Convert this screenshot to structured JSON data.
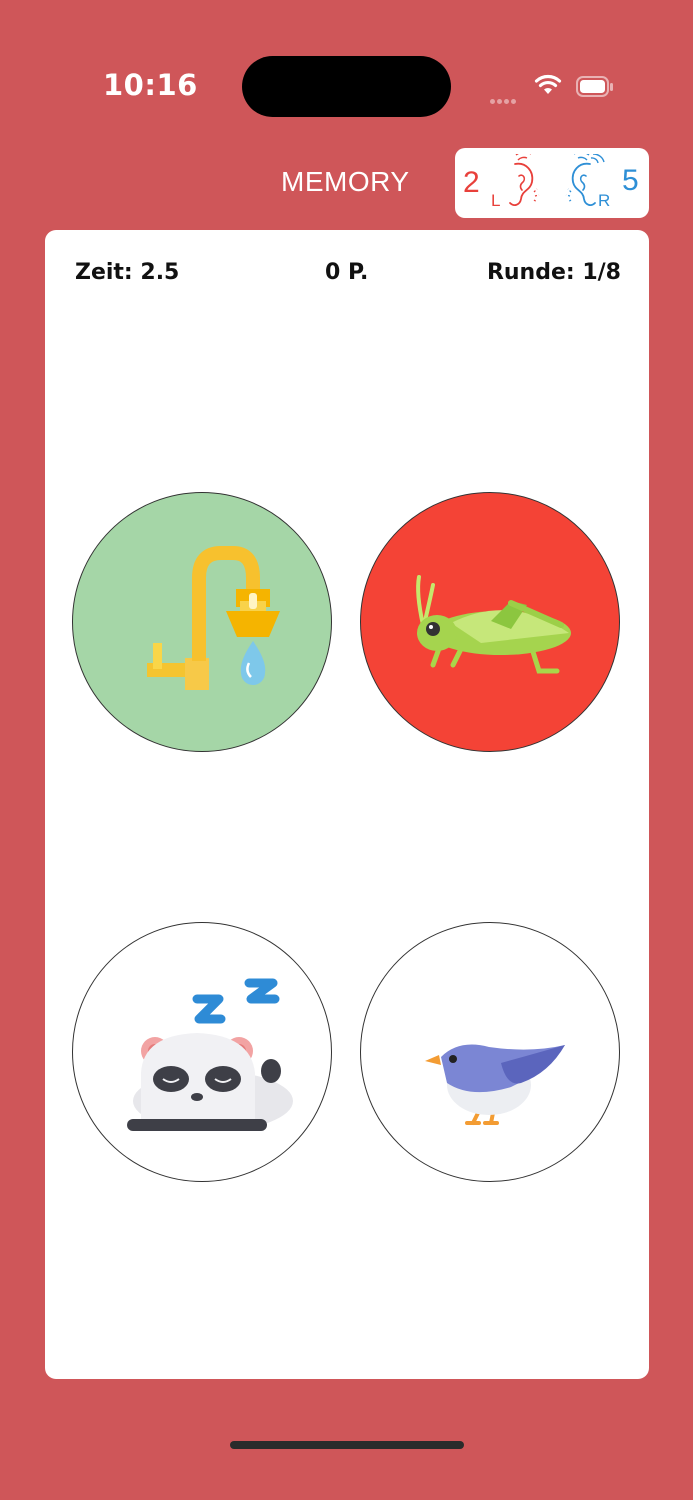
{
  "status_bar": {
    "time": "10:16",
    "icons": [
      "signal-dots-icon",
      "wifi-icon",
      "battery-icon"
    ]
  },
  "header": {
    "title": "MEMORY",
    "hearing": {
      "left_value": "2",
      "left_side": "L",
      "right_value": "5",
      "right_side": "R",
      "left_color": "#e8403b",
      "right_color": "#2e8fd6"
    }
  },
  "stats": {
    "time": "Zeit: 2.5",
    "points": "0 P.",
    "round": "Runde: 1/8"
  },
  "cards": [
    {
      "icon": "water-tap-icon",
      "background": "#a5d6a7"
    },
    {
      "icon": "grasshopper-icon",
      "background": "#f44336"
    },
    {
      "icon": "sleeping-panda-icon",
      "background": "#ffffff"
    },
    {
      "icon": "bird-icon",
      "background": "#ffffff"
    }
  ],
  "colors": {
    "background": "#cf5659",
    "panel": "#ffffff"
  }
}
